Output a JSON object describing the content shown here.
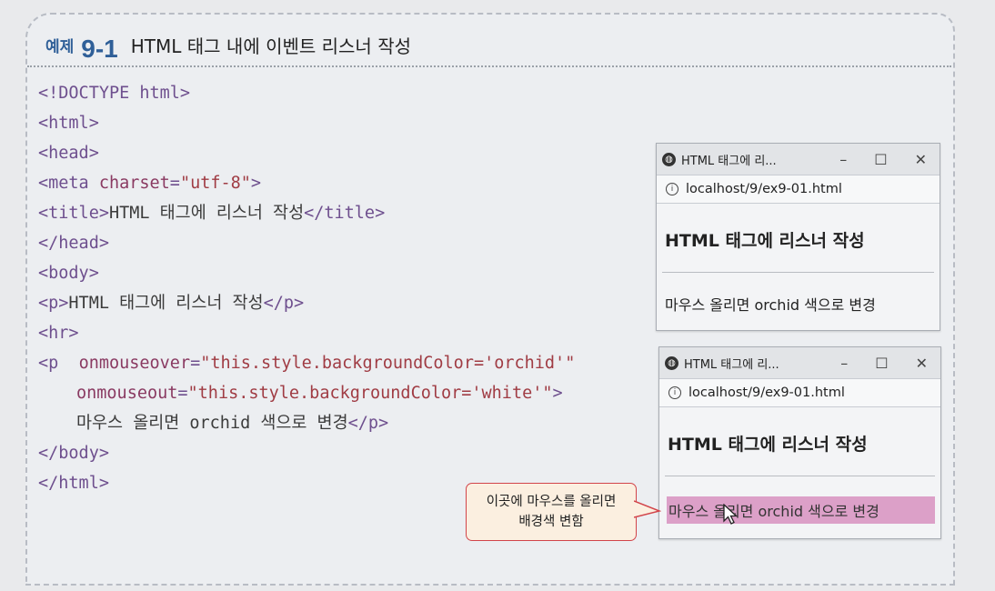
{
  "heading": {
    "label": "예제",
    "number": "9-1",
    "title": "HTML 태그 내에 이벤트 리스너 작성"
  },
  "code_lines": [
    [
      {
        "t": "tag",
        "v": "<!DOCTYPE html>"
      }
    ],
    [
      {
        "t": "tag",
        "v": "<html>"
      }
    ],
    [
      {
        "t": "tag",
        "v": "<head>"
      }
    ],
    [
      {
        "t": "tag",
        "v": "<meta "
      },
      {
        "t": "attr",
        "v": "charset"
      },
      {
        "t": "tag",
        "v": "="
      },
      {
        "t": "str",
        "v": "\"utf-8\""
      },
      {
        "t": "tag",
        "v": ">"
      }
    ],
    [
      {
        "t": "tag",
        "v": "<title>"
      },
      {
        "t": "txt",
        "v": "HTML 태그에 리스너 작성"
      },
      {
        "t": "tag",
        "v": "</title>"
      }
    ],
    [
      {
        "t": "tag",
        "v": "</head>"
      }
    ],
    [
      {
        "t": "tag",
        "v": "<body>"
      }
    ],
    [
      {
        "t": "tag",
        "v": "<p>"
      },
      {
        "t": "txt",
        "v": "HTML 태그에 리스너 작성"
      },
      {
        "t": "tag",
        "v": "</p>"
      }
    ],
    [
      {
        "t": "tag",
        "v": "<hr>"
      }
    ],
    [
      {
        "t": "tag",
        "v": "<p  "
      },
      {
        "t": "attr",
        "v": "onmouseover"
      },
      {
        "t": "tag",
        "v": "="
      },
      {
        "t": "str",
        "v": "\"this.style.backgroundColor='orchid'\""
      }
    ],
    [
      {
        "t": "ind",
        "v": ""
      },
      {
        "t": "attr",
        "v": "onmouseout"
      },
      {
        "t": "tag",
        "v": "="
      },
      {
        "t": "str",
        "v": "\"this.style.backgroundColor='white'\""
      },
      {
        "t": "tag",
        "v": ">"
      }
    ],
    [
      {
        "t": "ind",
        "v": ""
      },
      {
        "t": "txt",
        "v": "마우스 올리면 orchid 색으로 변경"
      },
      {
        "t": "tag",
        "v": "</p>"
      }
    ],
    [
      {
        "t": "tag",
        "v": "</body>"
      }
    ],
    [
      {
        "t": "tag",
        "v": "</html>"
      }
    ]
  ],
  "browser_before": {
    "tab_title": "HTML 태그에 리...",
    "address": "localhost/9/ex9-01.html",
    "heading": "HTML 태그에 리스너 작성",
    "paragraph": "마우스 올리면 orchid 색으로 변경"
  },
  "browser_after": {
    "tab_title": "HTML 태그에 리...",
    "address": "localhost/9/ex9-01.html",
    "heading": "HTML 태그에 리스너 작성",
    "paragraph": "마우스 올리면 orchid 색으로 변경",
    "hover_color": "#dca0c8"
  },
  "window_controls": {
    "minimize": "–",
    "maximize": "☐",
    "close": "✕"
  },
  "callout": {
    "line1": "이곳에 마우스를 올리면",
    "line2": "배경색 변함"
  }
}
